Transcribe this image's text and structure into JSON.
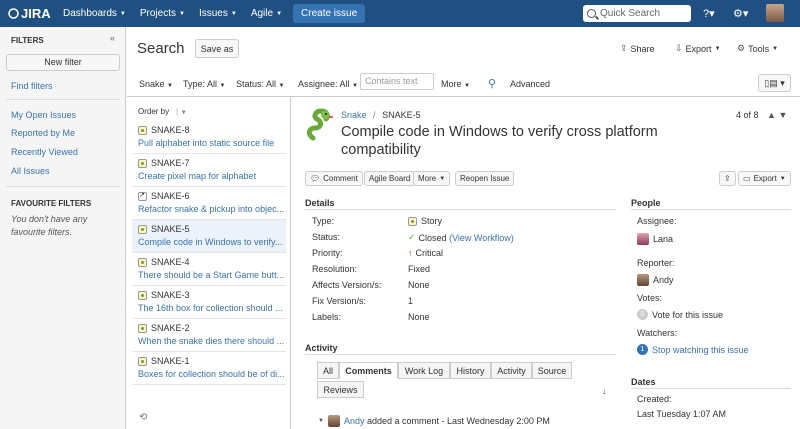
{
  "topnav": {
    "logo": "JIRA",
    "items": [
      "Dashboards",
      "Projects",
      "Issues",
      "Agile"
    ],
    "create": "Create issue",
    "search_placeholder": "Quick Search"
  },
  "sidebar": {
    "filters_heading": "FILTERS",
    "collapse": "«",
    "new_filter": "New filter",
    "find_filters": "Find filters",
    "items": [
      "My Open Issues",
      "Reported by Me",
      "Recently Viewed",
      "All Issues"
    ],
    "favourite_heading": "FAVOURITE FILTERS",
    "favourite_note": "You don't have any favourite filters."
  },
  "header": {
    "title": "Search",
    "save_as": "Save as",
    "share": "Share",
    "export": "Export",
    "tools": "Tools"
  },
  "filterbar": {
    "project": "Snake",
    "type": "Type: All",
    "status": "Status: All",
    "assignee": "Assignee: All",
    "contains_placeholder": "Contains text",
    "more": "More",
    "advanced": "Advanced"
  },
  "issuelist": {
    "order_by": "Order by",
    "issues": [
      {
        "key": "SNAKE-8",
        "summary": "Pull alphabet into static source file",
        "type": "story"
      },
      {
        "key": "SNAKE-7",
        "summary": "Create pixel map for alphabet",
        "type": "story"
      },
      {
        "key": "SNAKE-6",
        "summary": "Refactor snake & pickup into objec...",
        "type": "task"
      },
      {
        "key": "SNAKE-5",
        "summary": "Compile code in Windows to verify...",
        "type": "story"
      },
      {
        "key": "SNAKE-4",
        "summary": "There should be a Start Game butt...",
        "type": "story"
      },
      {
        "key": "SNAKE-3",
        "summary": "The 16th box for collection should ...",
        "type": "story"
      },
      {
        "key": "SNAKE-2",
        "summary": "When the snake dies there should ...",
        "type": "story"
      },
      {
        "key": "SNAKE-1",
        "summary": "Boxes for collection should be of di...",
        "type": "story"
      }
    ]
  },
  "issue": {
    "project": "Snake",
    "separator": "/",
    "key": "SNAKE-5",
    "title": "Compile code in Windows to verify cross platform compatibility",
    "pager": "4 of 8",
    "buttons": {
      "comment": "Comment",
      "agile_board": "Agile Board",
      "more": "More",
      "reopen": "Reopen Issue",
      "export": "Export"
    },
    "details_heading": "Details",
    "fields": {
      "type_label": "Type:",
      "type_value": "Story",
      "status_label": "Status:",
      "status_value": "Closed",
      "status_link": "(View Workflow)",
      "priority_label": "Priority:",
      "priority_value": "Critical",
      "resolution_label": "Resolution:",
      "resolution_value": "Fixed",
      "affects_label": "Affects Version/s:",
      "affects_value": "None",
      "fix_label": "Fix Version/s:",
      "fix_value": "1",
      "labels_label": "Labels:",
      "labels_value": "None"
    },
    "people": {
      "heading": "People",
      "assignee_label": "Assignee:",
      "assignee": "Lana",
      "reporter_label": "Reporter:",
      "reporter": "Andy",
      "votes_label": "Votes:",
      "votes_count": "0",
      "vote_link": "Vote for this issue",
      "watchers_label": "Watchers:",
      "watchers_count": "1",
      "watch_link": "Stop watching this issue"
    },
    "dates": {
      "heading": "Dates",
      "created_label": "Created:",
      "created_value": "Last Tuesday 1:07 AM"
    },
    "activity": {
      "heading": "Activity",
      "tabs": [
        "All",
        "Comments",
        "Work Log",
        "History",
        "Activity",
        "Source",
        "Reviews"
      ],
      "active_tab": "Comments",
      "comment_author": "Andy",
      "comment_text": "added a comment - Last Wednesday 2:00 PM"
    }
  },
  "colors": {
    "nav": "#205081",
    "link": "#3b73af",
    "selected_row": "#ebf2f9"
  }
}
